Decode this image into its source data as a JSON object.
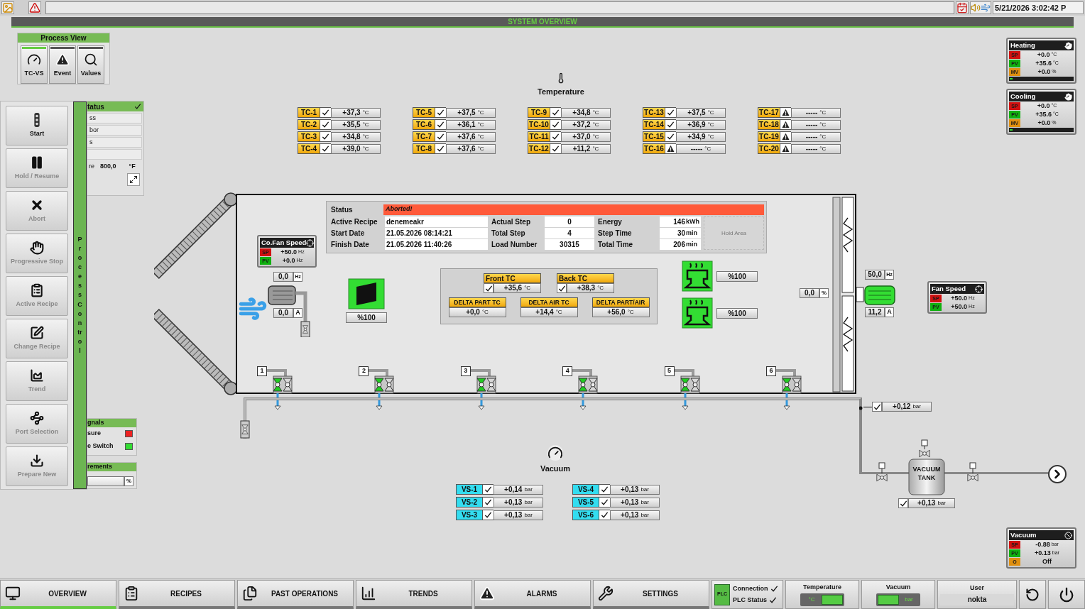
{
  "top_bar": {
    "datetime": "5/21/2026 3:02:42 P"
  },
  "header": {
    "title": "SYSTEM OVERVIEW"
  },
  "process_view": {
    "title": "Process View",
    "buttons": [
      {
        "label": "TC-VS",
        "selected": true
      },
      {
        "label": "Event",
        "selected": false
      },
      {
        "label": "Values",
        "selected": false
      }
    ]
  },
  "status_panel": {
    "title": "tatus",
    "rows": [
      "ss",
      "bor",
      "s"
    ],
    "reading_label": "re",
    "reading": "800,0",
    "unit": "°F"
  },
  "signals_panel": {
    "title": "gnals",
    "items": [
      {
        "label": "sure",
        "color": "#ee2222"
      },
      {
        "label": "e Switch",
        "color": "#33dd33"
      }
    ]
  },
  "measurements_panel": {
    "title": "rements",
    "unit": "%"
  },
  "process_control": {
    "title": "Process Control",
    "buttons": [
      {
        "label": "Start",
        "disabled": false
      },
      {
        "label": "Hold / Resume",
        "disabled": true
      },
      {
        "label": "Abort",
        "disabled": true
      },
      {
        "label": "Progressive Stop",
        "disabled": true
      },
      {
        "label": "Active Recipe",
        "disabled": true
      },
      {
        "label": "Change Recipe",
        "disabled": true
      },
      {
        "label": "Trend",
        "disabled": true
      },
      {
        "label": "Port Selection",
        "disabled": true
      },
      {
        "label": "Prepare New",
        "disabled": true
      }
    ]
  },
  "temperature": {
    "title": "Temperature",
    "sensors": [
      {
        "tag": "TC-1",
        "ok": true,
        "value": "+37,3",
        "unit": "°C"
      },
      {
        "tag": "TC-2",
        "ok": true,
        "value": "+35,5",
        "unit": "°C"
      },
      {
        "tag": "TC-3",
        "ok": true,
        "value": "+34,8",
        "unit": "°C"
      },
      {
        "tag": "TC-4",
        "ok": true,
        "value": "+39,0",
        "unit": "°C"
      },
      {
        "tag": "TC-5",
        "ok": true,
        "value": "+37,5",
        "unit": "°C"
      },
      {
        "tag": "TC-6",
        "ok": true,
        "value": "+36,1",
        "unit": "°C"
      },
      {
        "tag": "TC-7",
        "ok": true,
        "value": "+37,6",
        "unit": "°C"
      },
      {
        "tag": "TC-8",
        "ok": true,
        "value": "+37,6",
        "unit": "°C"
      },
      {
        "tag": "TC-9",
        "ok": true,
        "value": "+34,8",
        "unit": "°C"
      },
      {
        "tag": "TC-10",
        "ok": true,
        "value": "+37,2",
        "unit": "°C"
      },
      {
        "tag": "TC-11",
        "ok": true,
        "value": "+37,0",
        "unit": "°C"
      },
      {
        "tag": "TC-12",
        "ok": true,
        "value": "+11,2",
        "unit": "°C"
      },
      {
        "tag": "TC-13",
        "ok": true,
        "value": "+37,5",
        "unit": "°C"
      },
      {
        "tag": "TC-14",
        "ok": true,
        "value": "+36,9",
        "unit": "°C"
      },
      {
        "tag": "TC-15",
        "ok": true,
        "value": "+34,9",
        "unit": "°C"
      },
      {
        "tag": "TC-16",
        "ok": false,
        "value": "-----",
        "unit": "°C"
      },
      {
        "tag": "TC-17",
        "ok": false,
        "value": "-----",
        "unit": "°C"
      },
      {
        "tag": "TC-18",
        "ok": false,
        "value": "-----",
        "unit": "°C"
      },
      {
        "tag": "TC-19",
        "ok": false,
        "value": "-----",
        "unit": "°C"
      },
      {
        "tag": "TC-20",
        "ok": false,
        "value": "-----",
        "unit": "°C"
      }
    ]
  },
  "heating": {
    "title": "Heating",
    "kind": "manual",
    "level": 0,
    "rows": [
      {
        "tag": "SP",
        "color": "#d01010",
        "value": "+0.0",
        "unit": "°C"
      },
      {
        "tag": "PV",
        "color": "#10b010",
        "value": "+35.6",
        "unit": "°C"
      },
      {
        "tag": "MV",
        "color": "#e09010",
        "value": "+0.0",
        "unit": "%"
      }
    ]
  },
  "cooling": {
    "title": "Cooling",
    "kind": "manual",
    "level": 0,
    "rows": [
      {
        "tag": "SP",
        "color": "#d01010",
        "value": "+0.0",
        "unit": "°C"
      },
      {
        "tag": "PV",
        "color": "#10b010",
        "value": "+35.6",
        "unit": "°C"
      },
      {
        "tag": "MV",
        "color": "#e09010",
        "value": "+0.0",
        "unit": "%"
      }
    ]
  },
  "chamber_info": {
    "status_label": "Status",
    "status": "Aborted!",
    "hold_area": "Hold Area",
    "fields": [
      {
        "label": "Active Recipe",
        "value": "denemeakr"
      },
      {
        "label": "Actual Step",
        "value": "0"
      },
      {
        "label": "Energy",
        "value": "146",
        "unit": "kWh"
      },
      {
        "label": "Start Date",
        "value": "21.05.2026 08:14:21"
      },
      {
        "label": "Total Step",
        "value": "4"
      },
      {
        "label": "Step Time",
        "value": "30",
        "unit": "min"
      },
      {
        "label": "Finish Date",
        "value": "21.05.2026 11:40:26"
      },
      {
        "label": "Load Number",
        "value": "30315"
      },
      {
        "label": "Total Time",
        "value": "206",
        "unit": "min"
      }
    ]
  },
  "co_fan_speed": {
    "title": "Co.Fan Speed",
    "kind": "auto",
    "rows": [
      {
        "tag": "SP",
        "color": "#d01010",
        "value": "+50.0",
        "unit": "Hz"
      },
      {
        "tag": "PV",
        "color": "#10b010",
        "value": "+0.0",
        "unit": "Hz"
      }
    ]
  },
  "circulation_fan": {
    "frequency": "0,0",
    "frequency_unit": "Hz",
    "current": "0,0",
    "current_unit": "A"
  },
  "damper": {
    "opening": "%100"
  },
  "chamber_tc": {
    "sensors": [
      {
        "label": "Front TC",
        "ok": true,
        "value": "+35,6",
        "unit": "°C"
      },
      {
        "label": "Back TC",
        "ok": true,
        "value": "+38,3",
        "unit": "°C"
      }
    ],
    "deltas": [
      {
        "label": "DELTA PART TC",
        "value": "+0,0",
        "unit": "°C"
      },
      {
        "label": "DELTA AIR TC",
        "value": "+14,4",
        "unit": "°C"
      },
      {
        "label": "DELTA PART/AIR",
        "value": "+56,0",
        "unit": "°C"
      }
    ]
  },
  "heaters": [
    {
      "output": "%100"
    },
    {
      "output": "%100"
    }
  ],
  "cooling_output": {
    "value": "0,0",
    "unit": "%"
  },
  "main_fan": {
    "frequency": "50,0",
    "frequency_unit": "Hz",
    "current": "11,2",
    "current_unit": "A"
  },
  "fan_speed": {
    "title": "Fan Speed",
    "kind": "auto",
    "rows": [
      {
        "tag": "SP",
        "color": "#d01010",
        "value": "+50.0",
        "unit": "Hz"
      },
      {
        "tag": "PV",
        "color": "#10b010",
        "value": "+50.0",
        "unit": "Hz"
      }
    ]
  },
  "ports": [
    "1",
    "2",
    "3",
    "4",
    "5",
    "6"
  ],
  "line_pressure": {
    "ok": true,
    "value": "+0,12",
    "unit": "bar"
  },
  "vacuum": {
    "title": "Vacuum",
    "sensors": [
      {
        "tag": "VS-1",
        "ok": true,
        "value": "+0,14",
        "unit": "bar"
      },
      {
        "tag": "VS-2",
        "ok": true,
        "value": "+0,13",
        "unit": "bar"
      },
      {
        "tag": "VS-3",
        "ok": true,
        "value": "+0,13",
        "unit": "bar"
      },
      {
        "tag": "VS-4",
        "ok": true,
        "value": "+0,13",
        "unit": "bar"
      },
      {
        "tag": "VS-5",
        "ok": true,
        "value": "+0,13",
        "unit": "bar"
      },
      {
        "tag": "VS-6",
        "ok": true,
        "value": "+0,13",
        "unit": "bar"
      }
    ]
  },
  "vacuum_tank": {
    "label": "VACUUM TANK",
    "ok": true,
    "value": "+0,13",
    "unit": "bar"
  },
  "vacuum_controller": {
    "title": "Vacuum",
    "kind": "disabled",
    "rows": [
      {
        "tag": "SP",
        "color": "#d01010",
        "value": "-0.88",
        "unit": "bar"
      },
      {
        "tag": "PV",
        "color": "#10b010",
        "value": "+0.13",
        "unit": "bar"
      },
      {
        "tag": "O",
        "color": "#e09010",
        "value": "Off"
      }
    ]
  },
  "nav": {
    "tabs": [
      {
        "label": "OVERVIEW",
        "selected": true
      },
      {
        "label": "RECIPES",
        "selected": false
      },
      {
        "label": "PAST OPERATIONS",
        "selected": false
      },
      {
        "label": "TRENDS",
        "selected": false
      },
      {
        "label": "ALARMS",
        "selected": false
      },
      {
        "label": "SETTINGS",
        "selected": false
      }
    ],
    "plc": {
      "badge": "PLC",
      "connection": "Connection",
      "connection_ok": true,
      "status": "PLC Status",
      "status_ok": true
    },
    "temperature": {
      "title": "Temperature",
      "unit": "°C"
    },
    "vacuum": {
      "title": "Vacuum",
      "unit": "bar"
    },
    "user": {
      "title": "User",
      "name": "nokta"
    }
  }
}
